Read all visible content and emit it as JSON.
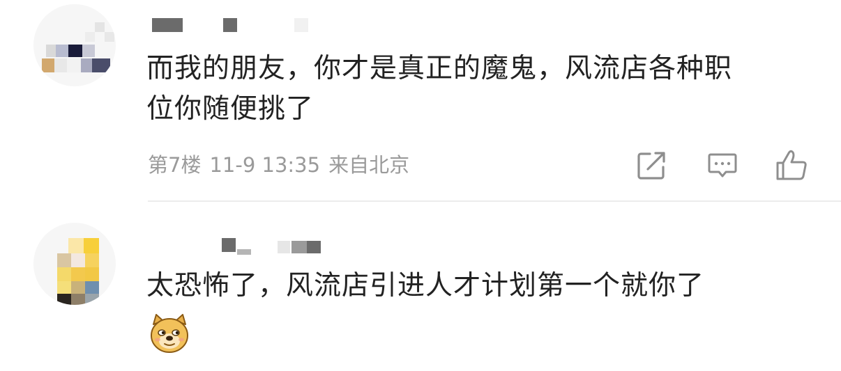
{
  "comments": [
    {
      "floor_info": "第7楼 11-9 13:35 来自北京",
      "meta": {
        "floor": "第7楼",
        "time": "11-9 13:35",
        "location": "来自北京"
      },
      "text_line1": "而我的朋友，你才是真正的魔鬼，风流店各种职",
      "text_line2": "位你随便挑了",
      "actions": {
        "share_icon": "share-icon",
        "reply_icon": "comment-icon",
        "like_icon": "thumbs-up-icon"
      }
    },
    {
      "text": "太恐怖了，风流店引进人才计划第一个就你了",
      "emoji": "doge-emoji"
    }
  ],
  "colors": {
    "text": "#222222",
    "meta": "#9a9a9a",
    "icon": "#8e8e8e",
    "divider": "#ececec"
  }
}
